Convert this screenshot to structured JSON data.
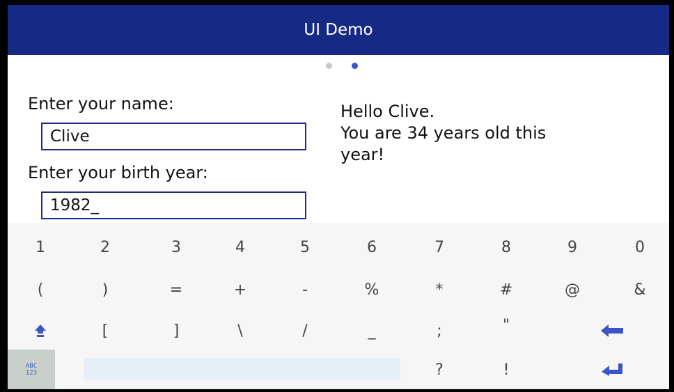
{
  "window": {
    "title": "UI Demo"
  },
  "pager": {
    "page_count": 2,
    "active_page": 2
  },
  "form": {
    "name_label": "Enter your name:",
    "name_value": "Clive",
    "year_label": "Enter your birth year:",
    "year_value": "1982_"
  },
  "output": {
    "line1": "Hello Clive.",
    "line2": "You are 34 years old this",
    "line3": "year!"
  },
  "keyboard": {
    "row1": [
      "1",
      "2",
      "3",
      "4",
      "5",
      "6",
      "7",
      "8",
      "9",
      "0"
    ],
    "row2": [
      "(",
      ")",
      "=",
      "+",
      "-",
      "%",
      "*",
      "#",
      "@",
      "&"
    ],
    "row3": [
      "[",
      "]",
      "\\",
      "/",
      "_",
      ";",
      "\""
    ],
    "row4": [
      "?",
      "!"
    ],
    "mode_label_top": "ABC",
    "mode_label_bottom": "123",
    "icons": {
      "shift": "shift-up-arrow-icon",
      "backspace": "backspace-arrow-icon",
      "enter": "enter-arrow-icon"
    }
  },
  "colors": {
    "titlebar": "#162a85",
    "accent": "#3b56c4",
    "field_border": "#1e2a86",
    "space_key": "#e6eef8",
    "mode_key": "#c9d0cc"
  }
}
